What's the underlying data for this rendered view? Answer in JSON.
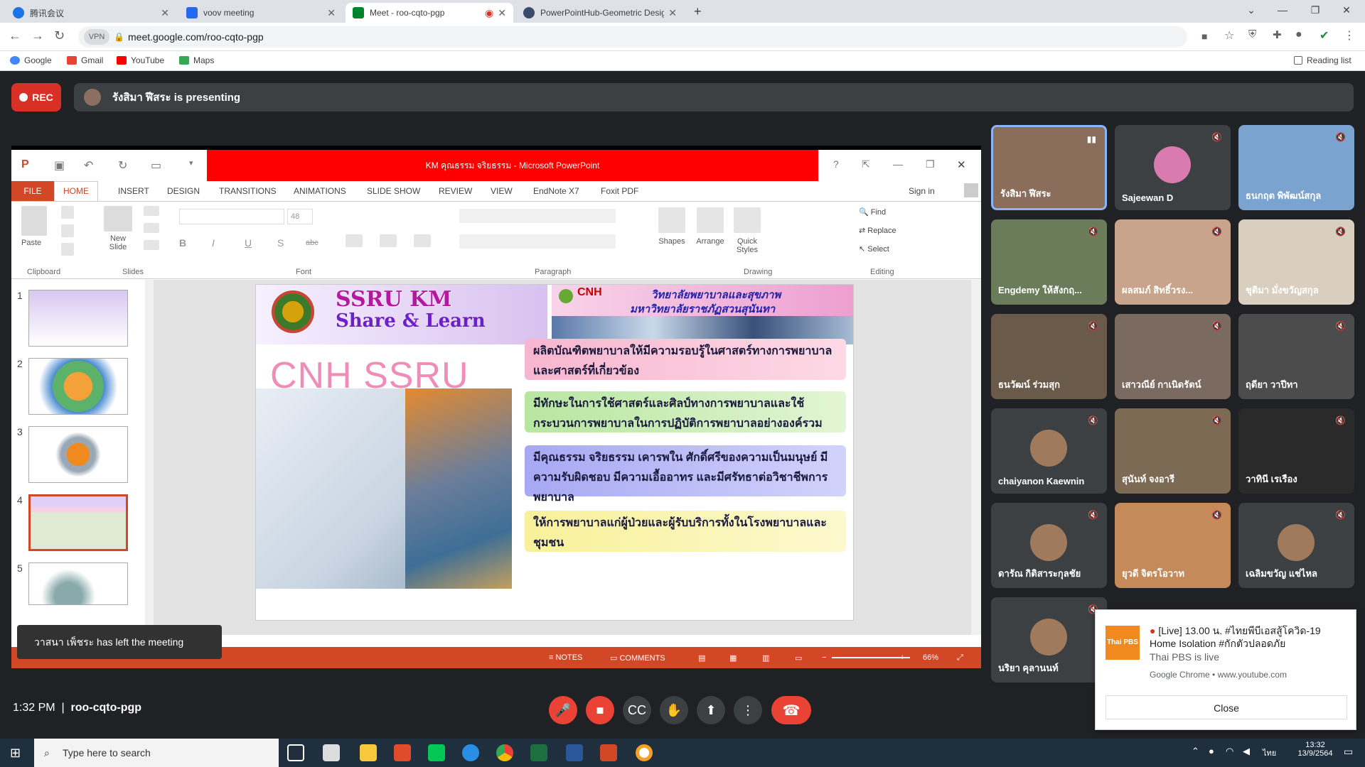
{
  "browser": {
    "tabs": [
      {
        "title": "腾讯会议",
        "active": false
      },
      {
        "title": "voov meeting",
        "active": false
      },
      {
        "title": "Meet - roo-cqto-pgp",
        "active": true
      },
      {
        "title": "PowerPointHub-Geometric Desig",
        "active": false
      }
    ],
    "url": "meet.google.com/roo-cqto-pgp",
    "bookmarks": [
      "Google",
      "Gmail",
      "YouTube",
      "Maps"
    ],
    "reading_list": "Reading list"
  },
  "meet": {
    "rec_label": "REC",
    "presenting": "รังสิมา ฬีสระ is presenting",
    "time": "1:32 PM",
    "meeting_code": "roo-cqto-pgp",
    "left_message": "วาสนา เพ็ชระ has left the meeting",
    "participants": [
      "รังสิมา ฬีสระ",
      "Sajeewan D",
      "ธนกฤต พิพัฒน์สกุล",
      "Engdemy ให้สังกฤ...",
      "ผลสมภ์ สิทธิ์วรง...",
      "ชุติมา มั่งขวัญสกุล",
      "ธนวัฒน์ ร่วมสุก",
      "เสาวณีย์ กาเนิดรัตน์",
      "ฤดียา วาปีทา",
      "chaiyanon Kaewnin",
      "สุนันท์ จงอารี",
      "วาทินี เรเรือง",
      "ดารัณ กิติสาระกุลชัย",
      "ยุวดี จิตรโอวาท",
      "เฉลิมขวัญ แช่ไหล",
      "นริยา คุลานนท์"
    ]
  },
  "notification": {
    "title": "[Live] 13.00 น. #ไทยพีบีเอสสู้โควิด-19 Home Isolation #กักตัวปลอดภัย",
    "subtitle": "Thai PBS is live",
    "source": "Google Chrome • www.youtube.com",
    "close": "Close",
    "logo": "Thai PBS"
  },
  "ppt": {
    "title": "KM คุณธรรม จริยธรรม - Microsoft PowerPoint",
    "tabs": [
      "FILE",
      "HOME",
      "INSERT",
      "DESIGN",
      "TRANSITIONS",
      "ANIMATIONS",
      "SLIDE SHOW",
      "REVIEW",
      "VIEW",
      "EndNote X7",
      "Foxit PDF"
    ],
    "sign_in": "Sign in",
    "groups": [
      "Clipboard",
      "Slides",
      "Font",
      "Paragraph",
      "Drawing",
      "Editing"
    ],
    "buttons": {
      "paste": "Paste",
      "new_slide": "New Slide",
      "shapes": "Shapes",
      "arrange": "Arrange",
      "quick_styles": "Quick Styles",
      "find": "Find",
      "replace": "Replace",
      "select": "Select",
      "font_size": "48"
    },
    "slide_numbers": [
      "1",
      "2",
      "3",
      "4",
      "5"
    ],
    "status": {
      "notes": "NOTES",
      "comments": "COMMENTS",
      "zoom": "66%"
    },
    "slide": {
      "header_left_1": "SSRU KM",
      "header_left_2": "Share & Learn",
      "header_right_1": "วิทยาลัยพยาบาลและสุขภาพ",
      "header_right_2": "มหาวิทยาลัยราชภัฏสวนสุนันทา",
      "cnh_label": "CNH",
      "big_title": "CNH SSRU",
      "boxes": [
        "ผลิตบัณฑิตพยาบาลให้มีความรอบรู้ในศาสตร์ทางการพยาบาลและศาสตร์ที่เกี่ยวข้อง",
        "มีทักษะในการใช้ศาสตร์และศิลป์ทางการพยาบาลและใช้กระบวนการพยาบาลในการปฏิบัติการพยาบาลอย่างองค์รวม",
        "มีคุณธรรม จริยธรรม เคารพใน ศักดิ์ศรีของความเป็นมนุษย์ มีความรับผิดชอบ มีความเอื้ออาทร และมีศรัทธาต่อวิชาชีพการพยาบาล",
        "ให้การพยาบาลแก่ผู้ป่วยและผู้รับบริการทั้งในโรงพยาบาลและชุมชน"
      ]
    }
  },
  "taskbar": {
    "search_placeholder": "Type here to search",
    "clock_time": "13:32",
    "clock_date": "13/9/2564",
    "lang": "ไทย"
  }
}
